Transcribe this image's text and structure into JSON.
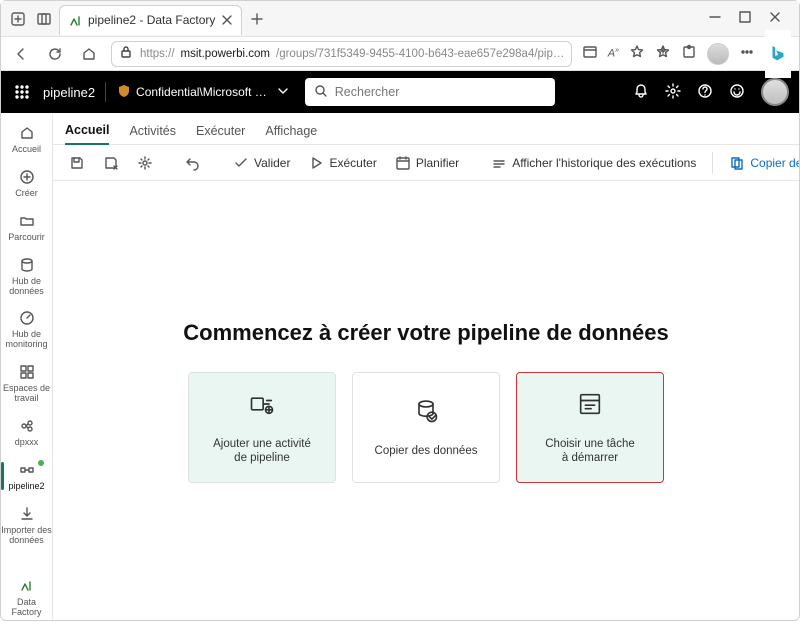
{
  "browser": {
    "tab_title": "pipeline2 - Data Factory",
    "url_host": "msit.powerbi.com",
    "url_path": "/groups/731f5349-9455-4100-b643-eae657e298a4/pip…",
    "url_prefix": "https://"
  },
  "header": {
    "context": "pipeline2",
    "sensitivity": "Confidential\\Microsoft …",
    "search_placeholder": "Rechercher"
  },
  "rail": [
    {
      "id": "home",
      "label": "Accueil"
    },
    {
      "id": "create",
      "label": "Créer"
    },
    {
      "id": "browse",
      "label": "Parcourir"
    },
    {
      "id": "datahub",
      "label": "Hub de données"
    },
    {
      "id": "monitor",
      "label": "Hub de monitoring"
    },
    {
      "id": "workspaces",
      "label": "Espaces de travail"
    },
    {
      "id": "dpxxx",
      "label": "dpxxx"
    },
    {
      "id": "pipeline2",
      "label": "pipeline2",
      "active": true,
      "dot": true
    },
    {
      "id": "import",
      "label": "Importer des données"
    }
  ],
  "rail_footer": {
    "label": "Data Factory"
  },
  "tabs": [
    {
      "label": "Accueil",
      "active": true
    },
    {
      "label": "Activités"
    },
    {
      "label": "Exécuter"
    },
    {
      "label": "Affichage"
    }
  ],
  "ribbon": {
    "validate": "Valider",
    "run": "Exécuter",
    "schedule": "Planifier",
    "history": "Afficher l'historique des exécutions",
    "copy": "Copier des données"
  },
  "canvas": {
    "title": "Commencez à créer votre pipeline de données",
    "cards": [
      {
        "line1": "Ajouter une activité",
        "line2": "de pipeline"
      },
      {
        "line1": "Copier des données",
        "line2": ""
      },
      {
        "line1": "Choisir une tâche",
        "line2": "à démarrer"
      }
    ]
  }
}
